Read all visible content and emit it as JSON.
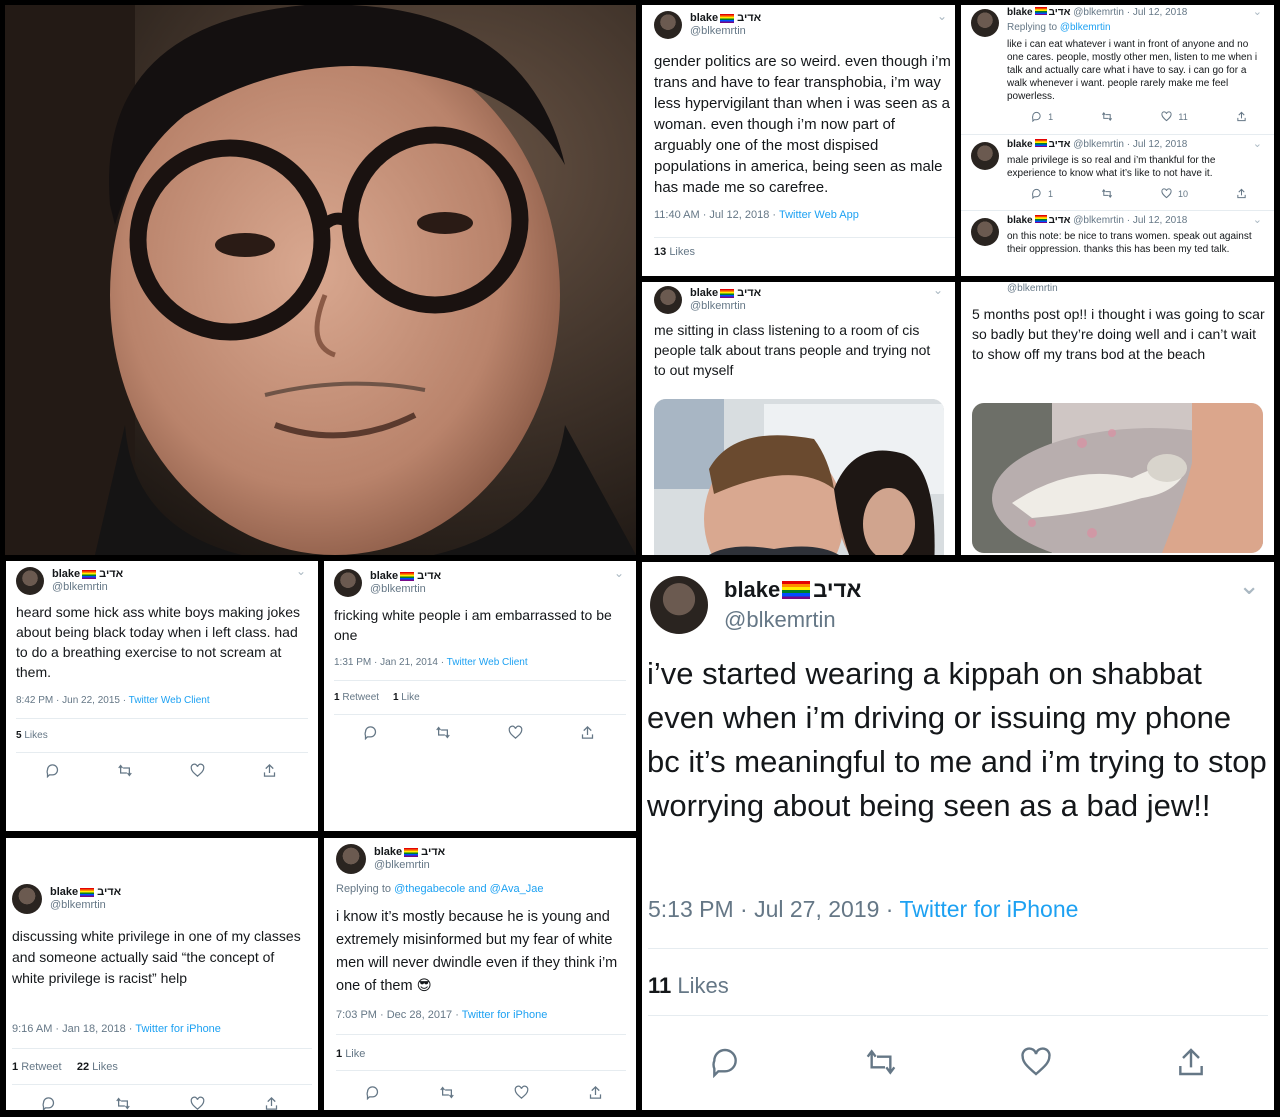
{
  "user": {
    "display_name": "blake",
    "hebrew_name": "אדיב",
    "handle": "@blkemrtin"
  },
  "flag_colors": [
    "#e40303",
    "#ff8c00",
    "#ffed00",
    "#008026",
    "#004dff",
    "#750787"
  ],
  "accent_color": "#1da1f2",
  "icons": [
    "reply-icon",
    "retweet-icon",
    "like-icon",
    "share-icon",
    "chevron-down-icon"
  ],
  "tweets": {
    "gender": {
      "text": "gender politics are so weird. even though i’m trans and have to fear transphobia, i’m way less hypervigilant than when i was seen as a woman. even though i’m now part of arguably one of the most dispised populations in america, being seen as male has made me so carefree.",
      "time": "11:40 AM · Jul 12, 2018 · ",
      "source": "Twitter Web App",
      "likes_count": "13",
      "likes_label": "Likes"
    },
    "thread": {
      "t1": {
        "date": "· Jul 12, 2018",
        "replying_prefix": "Replying to ",
        "replying_to": "@blkemrtin",
        "text": "like i can eat whatever i want in front of anyone and no one cares. people, mostly other men, listen to me when i talk and actually care what i have to say. i can go for a walk whenever i want. people rarely make me feel powerless.",
        "reply": "1",
        "like": "11"
      },
      "t2": {
        "date": "· Jul 12, 2018",
        "text": "male privilege is so real and i’m thankful for the experience to know what it’s like to not have it.",
        "reply": "1",
        "like": "10"
      },
      "t3": {
        "date": "· Jul 12, 2018",
        "text": "on this note: be nice to trans women. speak out against their oppression. thanks this has been my ted talk."
      }
    },
    "class": {
      "text": "me sitting in class listening to a room of cis people talk about trans people and trying not to out myself"
    },
    "postop": {
      "text": "5 months post op!! i thought i was going to scar so badly but they’re doing well and i can’t wait to show off my trans bod at the beach"
    },
    "hick": {
      "text": "heard some hick ass white boys making jokes about being black today when i left class. had to do a breathing exercise to not scream at them.",
      "time": "8:42 PM · Jun 22, 2015 · ",
      "source": "Twitter Web Client",
      "likes_count": "5",
      "likes_label": "Likes"
    },
    "fricking": {
      "text": "fricking white people i am embarrassed to be one",
      "time": "1:31 PM · Jan 21, 2014 · ",
      "source": "Twitter Web Client",
      "retweets_count": "1",
      "retweets_label": "Retweet",
      "likes_count": "1",
      "likes_label": "Like"
    },
    "kippah": {
      "text": "i’ve started wearing a kippah on shabbat even when i’m driving or issuing my phone bc it’s meaningful to me and i’m trying to stop worrying about being seen as a bad jew!!",
      "time": "5:13 PM · Jul 27, 2019 · ",
      "source": "Twitter for iPhone",
      "likes_count": "11",
      "likes_label": "Likes"
    },
    "privilege": {
      "text": "discussing white privilege in one of my classes and someone actually said “the concept of white privilege is racist” help",
      "time": "9:16 AM · Jan 18, 2018 · ",
      "source": "Twitter for iPhone",
      "retweets_count": "1",
      "retweets_label": "Retweet",
      "likes_count": "22",
      "likes_label": "Likes"
    },
    "fear": {
      "replying_prefix": "Replying to ",
      "replying_to": "@thegabecole and @Ava_Jae",
      "text": "i know it’s mostly because he is young and extremely misinformed but my fear of white men will never dwindle even if they think i’m one of them 😎",
      "time": "7:03 PM · Dec 28, 2017 · ",
      "source": "Twitter for iPhone",
      "likes_count": "1",
      "likes_label": "Like"
    }
  }
}
